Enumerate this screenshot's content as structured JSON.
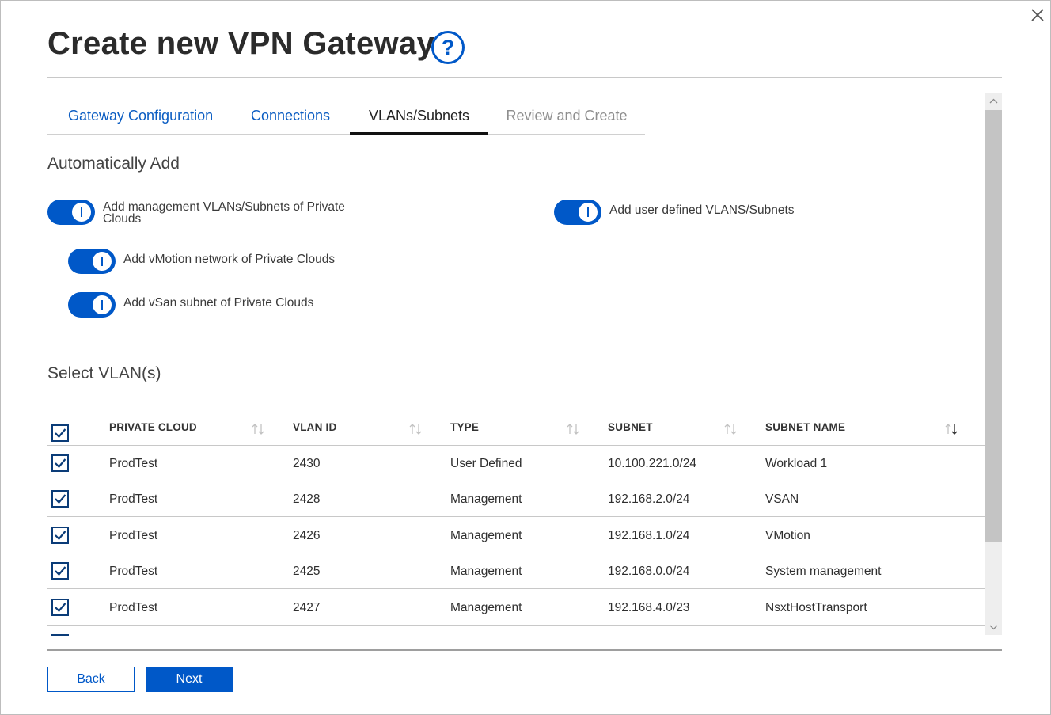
{
  "dialog": {
    "title": "Create new VPN Gateway",
    "help_glyph": "?"
  },
  "tabs": [
    {
      "label": "Gateway Configuration",
      "state": "link"
    },
    {
      "label": "Connections",
      "state": "link"
    },
    {
      "label": "VLANs/Subnets",
      "state": "active"
    },
    {
      "label": "Review and Create",
      "state": "disabled"
    }
  ],
  "auto_add": {
    "heading": "Automatically Add",
    "toggles": [
      {
        "label": "Add management VLANs/Subnets of Private Clouds",
        "on": true
      },
      {
        "label": "Add vMotion network of Private Clouds",
        "on": true
      },
      {
        "label": "Add vSan subnet of Private Clouds",
        "on": true
      },
      {
        "label": "Add user defined VLANS/Subnets",
        "on": true
      }
    ]
  },
  "select_vlans": {
    "heading": "Select VLAN(s)",
    "columns": [
      "PRIVATE CLOUD",
      "VLAN ID",
      "TYPE",
      "SUBNET",
      "SUBNET NAME"
    ],
    "rows": [
      {
        "checked": true,
        "private_cloud": "ProdTest",
        "vlan_id": "2430",
        "type": "User Defined",
        "subnet": "10.100.221.0/24",
        "subnet_name": "Workload 1"
      },
      {
        "checked": true,
        "private_cloud": "ProdTest",
        "vlan_id": "2428",
        "type": "Management",
        "subnet": "192.168.2.0/24",
        "subnet_name": "VSAN"
      },
      {
        "checked": true,
        "private_cloud": "ProdTest",
        "vlan_id": "2426",
        "type": "Management",
        "subnet": "192.168.1.0/24",
        "subnet_name": "VMotion"
      },
      {
        "checked": true,
        "private_cloud": "ProdTest",
        "vlan_id": "2425",
        "type": "Management",
        "subnet": "192.168.0.0/24",
        "subnet_name": "System management"
      },
      {
        "checked": true,
        "private_cloud": "ProdTest",
        "vlan_id": "2427",
        "type": "Management",
        "subnet": "192.168.4.0/23",
        "subnet_name": "NsxtHostTransport"
      }
    ]
  },
  "footer": {
    "back_label": "Back",
    "next_label": "Next"
  },
  "colors": {
    "accent": "#0058c8",
    "link": "#0a5cc2",
    "checkbox_border": "#0b3c78"
  },
  "icons": {
    "close": "close-icon",
    "help": "help-icon",
    "sort": "sort-arrows-icon",
    "check": "checkmark-icon"
  }
}
